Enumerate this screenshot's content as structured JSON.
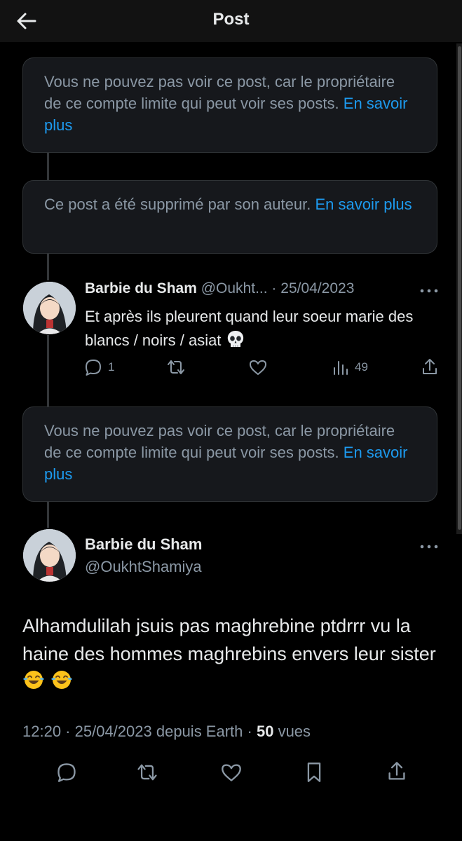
{
  "header": {
    "title": "Post"
  },
  "notice1": {
    "text": "Vous ne pouvez pas voir ce post, car le propriétaire de ce compte limite qui peut voir ses posts. ",
    "link": "En savoir plus"
  },
  "notice2": {
    "text": "Ce post a été supprimé par son auteur. ",
    "link": "En savoir plus"
  },
  "reply": {
    "name": "Barbie du Sham",
    "handle": "@Oukht...",
    "separator": "·",
    "date": "25/04/2023",
    "text": "Et après ils pleurent quand leur soeur marie des blancs / noirs / asiat",
    "emoji": "skull",
    "reply_count": "1",
    "views_count": "49"
  },
  "notice3": {
    "text": "Vous ne pouvez pas voir ce post, car le propriétaire de ce compte limite qui peut voir ses posts. ",
    "link": "En savoir plus"
  },
  "main_post": {
    "name": "Barbie du Sham",
    "handle": "@OukhtShamiya",
    "text": "Alhamdulilah jsuis pas maghrebine ptdrrr vu la haine des hommes maghrebins envers leur sister",
    "emoji": "face-with-tears-of-joy",
    "time": "12:20",
    "date": "25/04/2023",
    "source": "depuis Earth",
    "views_count": "50",
    "views_label": "vues"
  },
  "colors": {
    "background": "#000000",
    "card": "#16181c",
    "link": "#1d9bf0",
    "muted": "#8b98a5",
    "text": "#e7e9ea"
  }
}
